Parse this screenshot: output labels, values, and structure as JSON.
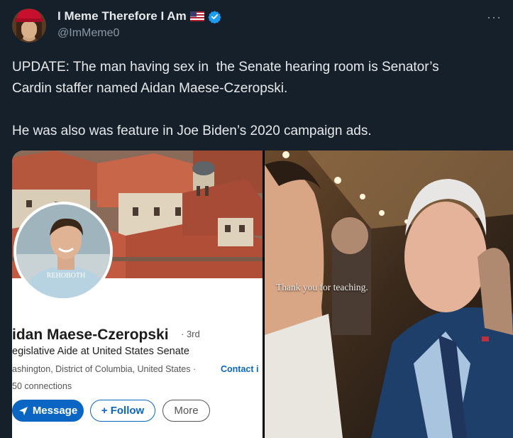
{
  "author": {
    "display_name": "I Meme Therefore I Am",
    "handle": "@ImMeme0",
    "verified": true,
    "flag": "us-flag",
    "icons": [
      "us-flag-icon",
      "verified-icon",
      "more-icon"
    ],
    "more_glyph": "···"
  },
  "tweet": {
    "line1": "UPDATE: The man having sex in  the Senate hearing room is Senator’s",
    "line2": "Cardin staffer named Aidan Maese-Czeropski.",
    "line3": "He was also was feature in Joe Biden’s 2020 campaign ads."
  },
  "media_left": {
    "name": "idan Maese-Czeropski",
    "degree": "· 3rd",
    "title": "egislative Aide at United States Senate",
    "location": "ashington, District of Columbia, United States ·",
    "contact": "Contact i",
    "connections": "50 connections",
    "shirt_text": "REHOBOTH",
    "buttons": {
      "message": "Message",
      "follow": "+ Follow",
      "more": "More"
    }
  },
  "media_right": {
    "caption": "Thank you for teaching."
  },
  "colors": {
    "background": "#15202b",
    "linkedin_blue": "#0a66c2",
    "verified_blue": "#1d9bf0"
  }
}
